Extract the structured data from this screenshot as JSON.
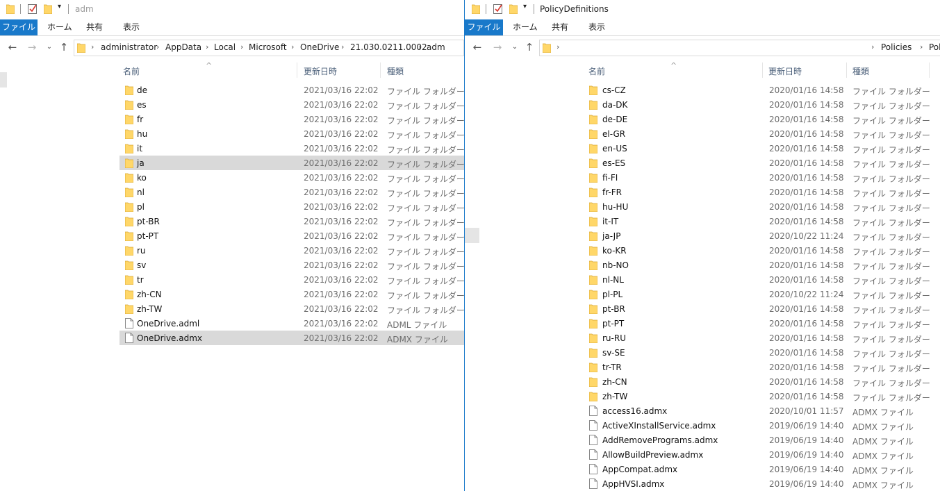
{
  "colors": {
    "accent": "#1979ca",
    "folder": "#ffd769",
    "selected": "#d9d9d9"
  },
  "left": {
    "title": "adm",
    "ribbon": {
      "file": "ファイル",
      "home": "ホーム",
      "share": "共有",
      "view": "表示"
    },
    "breadcrumb": [
      "administrator",
      "AppData",
      "Local",
      "Microsoft",
      "OneDrive",
      "21.030.0211.0002",
      "adm"
    ],
    "columns": {
      "name": "名前",
      "date": "更新日時",
      "type": "種類"
    },
    "rows": [
      {
        "name": "de",
        "date": "2021/03/16 22:02",
        "type": "ファイル フォルダー",
        "icon": "folder"
      },
      {
        "name": "es",
        "date": "2021/03/16 22:02",
        "type": "ファイル フォルダー",
        "icon": "folder"
      },
      {
        "name": "fr",
        "date": "2021/03/16 22:02",
        "type": "ファイル フォルダー",
        "icon": "folder"
      },
      {
        "name": "hu",
        "date": "2021/03/16 22:02",
        "type": "ファイル フォルダー",
        "icon": "folder"
      },
      {
        "name": "it",
        "date": "2021/03/16 22:02",
        "type": "ファイル フォルダー",
        "icon": "folder"
      },
      {
        "name": "ja",
        "date": "2021/03/16 22:02",
        "type": "ファイル フォルダー",
        "icon": "folder",
        "selected": true
      },
      {
        "name": "ko",
        "date": "2021/03/16 22:02",
        "type": "ファイル フォルダー",
        "icon": "folder"
      },
      {
        "name": "nl",
        "date": "2021/03/16 22:02",
        "type": "ファイル フォルダー",
        "icon": "folder"
      },
      {
        "name": "pl",
        "date": "2021/03/16 22:02",
        "type": "ファイル フォルダー",
        "icon": "folder"
      },
      {
        "name": "pt-BR",
        "date": "2021/03/16 22:02",
        "type": "ファイル フォルダー",
        "icon": "folder"
      },
      {
        "name": "pt-PT",
        "date": "2021/03/16 22:02",
        "type": "ファイル フォルダー",
        "icon": "folder"
      },
      {
        "name": "ru",
        "date": "2021/03/16 22:02",
        "type": "ファイル フォルダー",
        "icon": "folder"
      },
      {
        "name": "sv",
        "date": "2021/03/16 22:02",
        "type": "ファイル フォルダー",
        "icon": "folder"
      },
      {
        "name": "tr",
        "date": "2021/03/16 22:02",
        "type": "ファイル フォルダー",
        "icon": "folder"
      },
      {
        "name": "zh-CN",
        "date": "2021/03/16 22:02",
        "type": "ファイル フォルダー",
        "icon": "folder"
      },
      {
        "name": "zh-TW",
        "date": "2021/03/16 22:02",
        "type": "ファイル フォルダー",
        "icon": "folder"
      },
      {
        "name": "OneDrive.adml",
        "date": "2021/03/16 22:02",
        "type": "ADML ファイル",
        "icon": "file"
      },
      {
        "name": "OneDrive.admx",
        "date": "2021/03/16 22:02",
        "type": "ADMX ファイル",
        "icon": "file",
        "selected": true
      }
    ]
  },
  "right": {
    "title": "PolicyDefinitions",
    "ribbon": {
      "file": "ファイル",
      "home": "ホーム",
      "share": "共有",
      "view": "表示"
    },
    "breadcrumb": [
      "Policies",
      "Poli"
    ],
    "columns": {
      "name": "名前",
      "date": "更新日時",
      "type": "種類"
    },
    "rows": [
      {
        "name": "cs-CZ",
        "date": "2020/01/16 14:58",
        "type": "ファイル フォルダー",
        "icon": "folder"
      },
      {
        "name": "da-DK",
        "date": "2020/01/16 14:58",
        "type": "ファイル フォルダー",
        "icon": "folder"
      },
      {
        "name": "de-DE",
        "date": "2020/01/16 14:58",
        "type": "ファイル フォルダー",
        "icon": "folder"
      },
      {
        "name": "el-GR",
        "date": "2020/01/16 14:58",
        "type": "ファイル フォルダー",
        "icon": "folder"
      },
      {
        "name": "en-US",
        "date": "2020/01/16 14:58",
        "type": "ファイル フォルダー",
        "icon": "folder"
      },
      {
        "name": "es-ES",
        "date": "2020/01/16 14:58",
        "type": "ファイル フォルダー",
        "icon": "folder"
      },
      {
        "name": "fi-FI",
        "date": "2020/01/16 14:58",
        "type": "ファイル フォルダー",
        "icon": "folder"
      },
      {
        "name": "fr-FR",
        "date": "2020/01/16 14:58",
        "type": "ファイル フォルダー",
        "icon": "folder"
      },
      {
        "name": "hu-HU",
        "date": "2020/01/16 14:58",
        "type": "ファイル フォルダー",
        "icon": "folder"
      },
      {
        "name": "it-IT",
        "date": "2020/01/16 14:58",
        "type": "ファイル フォルダー",
        "icon": "folder"
      },
      {
        "name": "ja-JP",
        "date": "2020/10/22 11:24",
        "type": "ファイル フォルダー",
        "icon": "folder"
      },
      {
        "name": "ko-KR",
        "date": "2020/01/16 14:58",
        "type": "ファイル フォルダー",
        "icon": "folder"
      },
      {
        "name": "nb-NO",
        "date": "2020/01/16 14:58",
        "type": "ファイル フォルダー",
        "icon": "folder"
      },
      {
        "name": "nl-NL",
        "date": "2020/01/16 14:58",
        "type": "ファイル フォルダー",
        "icon": "folder"
      },
      {
        "name": "pl-PL",
        "date": "2020/10/22 11:24",
        "type": "ファイル フォルダー",
        "icon": "folder"
      },
      {
        "name": "pt-BR",
        "date": "2020/01/16 14:58",
        "type": "ファイル フォルダー",
        "icon": "folder"
      },
      {
        "name": "pt-PT",
        "date": "2020/01/16 14:58",
        "type": "ファイル フォルダー",
        "icon": "folder"
      },
      {
        "name": "ru-RU",
        "date": "2020/01/16 14:58",
        "type": "ファイル フォルダー",
        "icon": "folder"
      },
      {
        "name": "sv-SE",
        "date": "2020/01/16 14:58",
        "type": "ファイル フォルダー",
        "icon": "folder"
      },
      {
        "name": "tr-TR",
        "date": "2020/01/16 14:58",
        "type": "ファイル フォルダー",
        "icon": "folder"
      },
      {
        "name": "zh-CN",
        "date": "2020/01/16 14:58",
        "type": "ファイル フォルダー",
        "icon": "folder"
      },
      {
        "name": "zh-TW",
        "date": "2020/01/16 14:58",
        "type": "ファイル フォルダー",
        "icon": "folder"
      },
      {
        "name": "access16.admx",
        "date": "2020/10/01 11:57",
        "type": "ADMX ファイル",
        "icon": "file"
      },
      {
        "name": "ActiveXInstallService.admx",
        "date": "2019/06/19 14:40",
        "type": "ADMX ファイル",
        "icon": "file"
      },
      {
        "name": "AddRemovePrograms.admx",
        "date": "2019/06/19 14:40",
        "type": "ADMX ファイル",
        "icon": "file"
      },
      {
        "name": "AllowBuildPreview.admx",
        "date": "2019/06/19 14:40",
        "type": "ADMX ファイル",
        "icon": "file"
      },
      {
        "name": "AppCompat.admx",
        "date": "2019/06/19 14:40",
        "type": "ADMX ファイル",
        "icon": "file"
      },
      {
        "name": "AppHVSI.admx",
        "date": "2019/06/19 14:40",
        "type": "ADMX ファイル",
        "icon": "file"
      }
    ]
  }
}
